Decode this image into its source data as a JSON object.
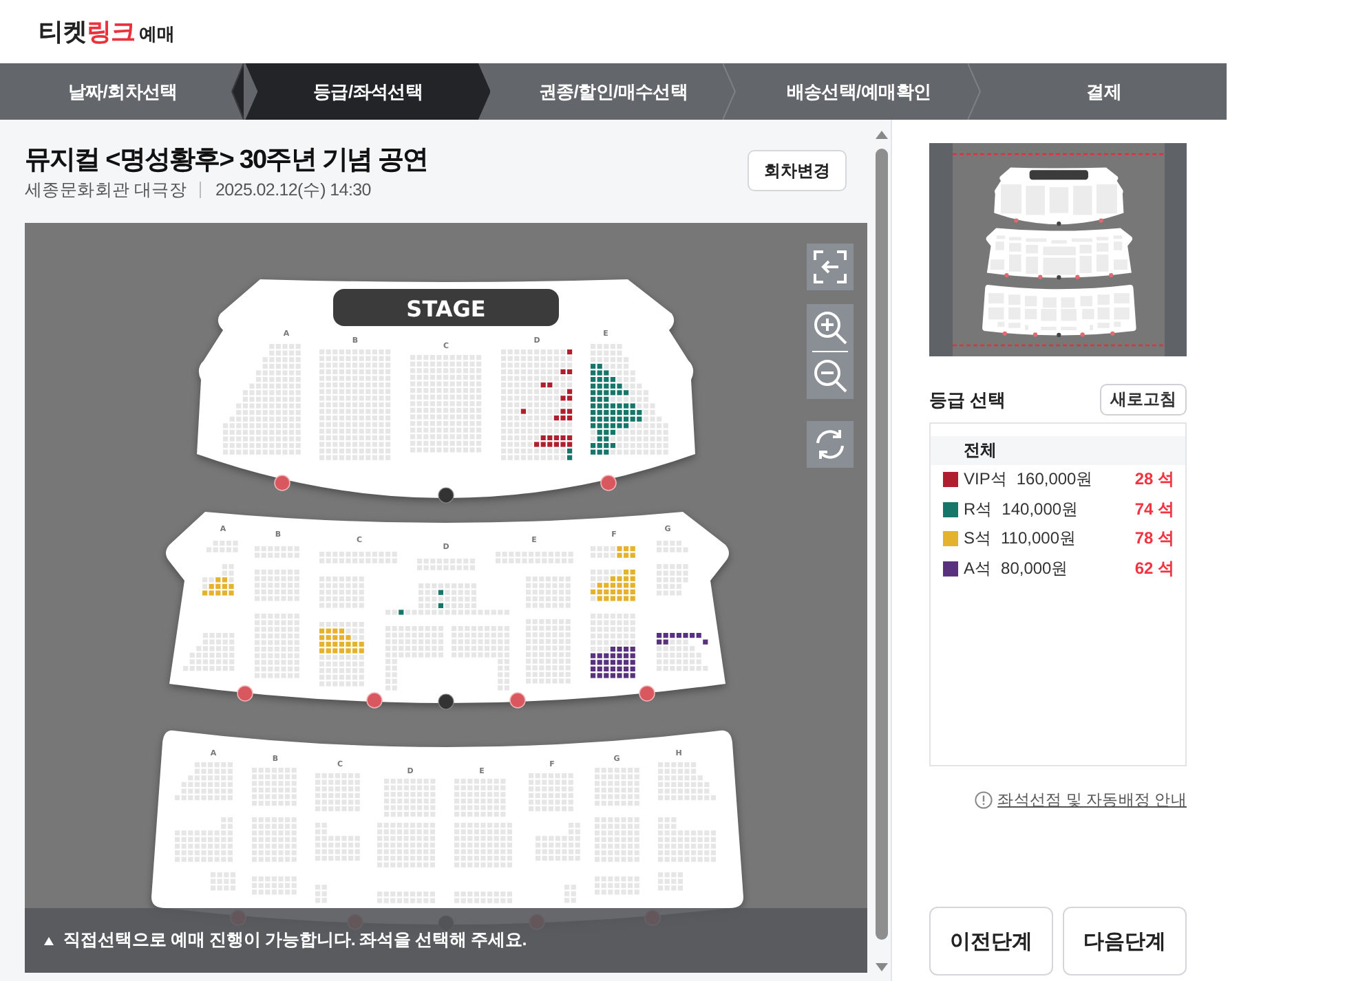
{
  "header": {
    "logo": {
      "parts": [
        {
          "text": "티켓",
          "accent": false
        },
        {
          "text": "링크",
          "accent": true
        }
      ],
      "suffix": "예매"
    }
  },
  "steps": [
    {
      "label": "날짜/회차선택",
      "selected": false
    },
    {
      "label": "등급/좌석선택",
      "selected": true
    },
    {
      "label": "권종/할인/매수선택",
      "selected": false
    },
    {
      "label": "배송선택/예매확인",
      "selected": false
    },
    {
      "label": "결제",
      "selected": false
    }
  ],
  "performance": {
    "title": "뮤지컬 <명성황후> 30주년 기념 공연",
    "venue": "세종문화회관 대극장",
    "datetime": "2025.02.12(수) 14:30",
    "change_button": "회차변경"
  },
  "seat_map": {
    "stage": "STAGE",
    "floors": [
      {
        "sections": [
          "A",
          "B",
          "C",
          "D",
          "E"
        ]
      },
      {
        "sections": [
          "A",
          "B",
          "C",
          "D",
          "E",
          "F",
          "G"
        ]
      },
      {
        "sections": [
          "A",
          "B",
          "C",
          "D",
          "E",
          "F",
          "G",
          "H"
        ]
      }
    ],
    "notice": "직접선택으로 예매 진행이 가능합니다. 좌석을 선택해 주세요."
  },
  "grade_panel": {
    "title": "등급 선택",
    "refresh_button": "새로고침",
    "all_label": "전체",
    "grades": [
      {
        "name": "VIP석",
        "price": "160,000원",
        "available": "28 석",
        "color": "#b01f2d"
      },
      {
        "name": "R석",
        "price": "140,000원",
        "available": "74 석",
        "color": "#17766a"
      },
      {
        "name": "S석",
        "price": "110,000원",
        "available": "78 석",
        "color": "#e5b22e"
      },
      {
        "name": "A석",
        "price": "80,000원",
        "available": "62 석",
        "color": "#58327e"
      }
    ],
    "info_link": "좌석선점 및 자동배정 안내"
  },
  "footer_buttons": [
    "이전단계",
    "다음단계"
  ]
}
